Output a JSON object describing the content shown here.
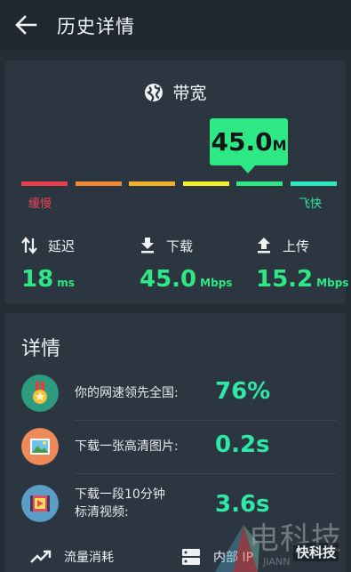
{
  "header": {
    "title": "历史详情",
    "back_icon": "arrow-left-icon"
  },
  "bandwidth": {
    "title": "带宽",
    "icon": "globe-icon",
    "value": "45.0",
    "unit": "M",
    "scale_colors": [
      "#e8404e",
      "#ef8a2e",
      "#f3b02a",
      "#f2ee2a",
      "#2ee886",
      "#2ee8c2"
    ],
    "slow_label": "缓慢",
    "fast_label": "飞快",
    "highlight_color": "#2ee886"
  },
  "stats": {
    "latency": {
      "label": "延迟",
      "value": "18",
      "unit": "ms",
      "icon": "up-down-arrows-icon"
    },
    "download": {
      "label": "下载",
      "value": "45.0",
      "unit": "Mbps",
      "icon": "download-icon"
    },
    "upload": {
      "label": "上传",
      "value": "15.2",
      "unit": "Mbps",
      "icon": "upload-icon"
    }
  },
  "details": {
    "title": "详情",
    "rows": [
      {
        "label": "你的网速领先全国:",
        "value": "76%",
        "icon": "medal-icon",
        "icon_color": "#2e9a7e"
      },
      {
        "label": "下载一张高清图片:",
        "value": "0.2s",
        "icon": "picture-icon",
        "icon_color": "#ee8a5a"
      },
      {
        "label_line1": "下载一段10分钟",
        "label_line2": "标清视频:",
        "value": "3.6s",
        "icon": "video-icon",
        "icon_color": "#5a9ec6"
      }
    ],
    "bottom": [
      {
        "label": "流量消耗",
        "icon": "trend-icon"
      },
      {
        "label": "内部 IP",
        "icon": "server-icon"
      }
    ]
  },
  "watermark": {
    "text": "电科技",
    "sub": "JIANN",
    "logo": "快科技"
  }
}
